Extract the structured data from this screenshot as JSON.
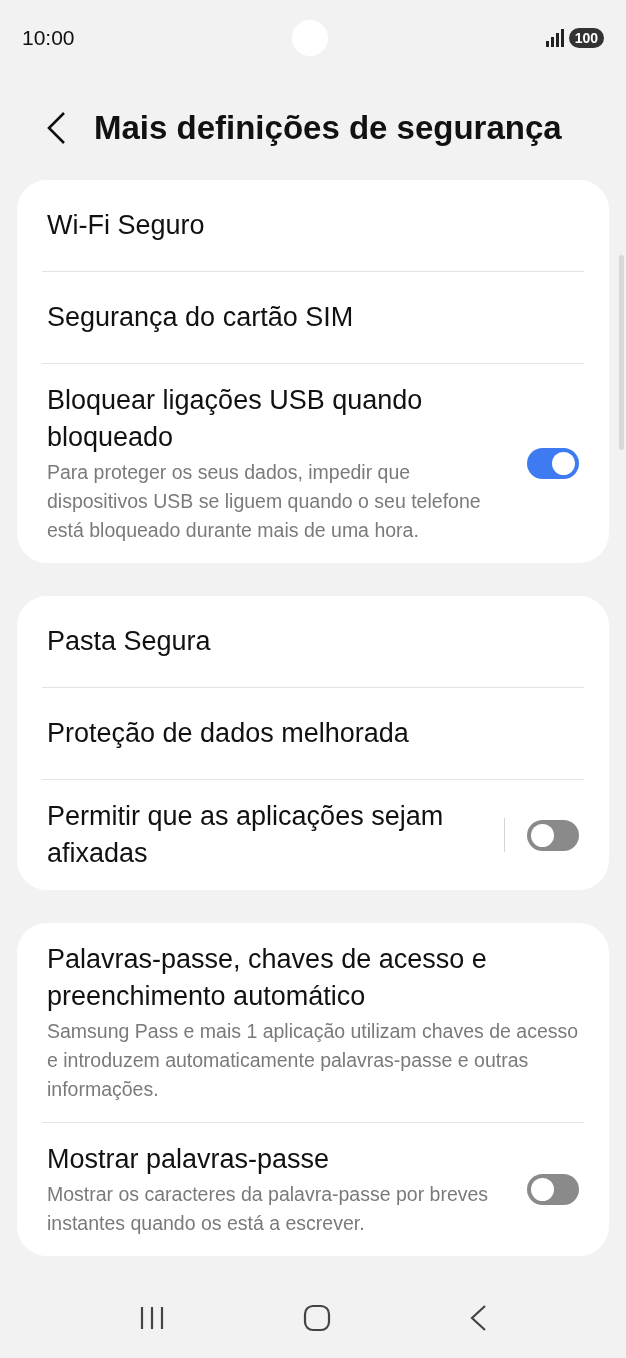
{
  "status_bar": {
    "time": "10:00",
    "battery": "100"
  },
  "header": {
    "title": "Mais definições de segurança"
  },
  "sections": [
    {
      "items": [
        {
          "kind": "link",
          "title": "Wi-Fi Seguro"
        },
        {
          "kind": "link",
          "title": "Segurança do cartão SIM"
        },
        {
          "kind": "switch",
          "title": "Bloquear ligações USB quando bloqueado",
          "description": "Para proteger os seus dados, impedir que dispositivos USB se liguem quando o seu telefone está bloqueado durante mais de uma hora.",
          "on": true,
          "split": false
        }
      ]
    },
    {
      "items": [
        {
          "kind": "link",
          "title": "Pasta Segura"
        },
        {
          "kind": "link",
          "title": "Proteção de dados melhorada"
        },
        {
          "kind": "switch",
          "title": "Permitir que as aplicações sejam afixadas",
          "on": false,
          "split": true
        }
      ]
    },
    {
      "items": [
        {
          "kind": "link",
          "title": "Palavras-passe, chaves de acesso e preenchimento automático",
          "description": "Samsung Pass e mais 1 aplicação utilizam chaves de acesso e introduzem automaticamente palavras-passe e outras informações."
        },
        {
          "kind": "switch",
          "title": "Mostrar palavras-passe",
          "description": "Mostrar os caracteres da palavra-passe por breves instantes quando os está a escrever.",
          "on": false,
          "split": false
        }
      ]
    }
  ]
}
